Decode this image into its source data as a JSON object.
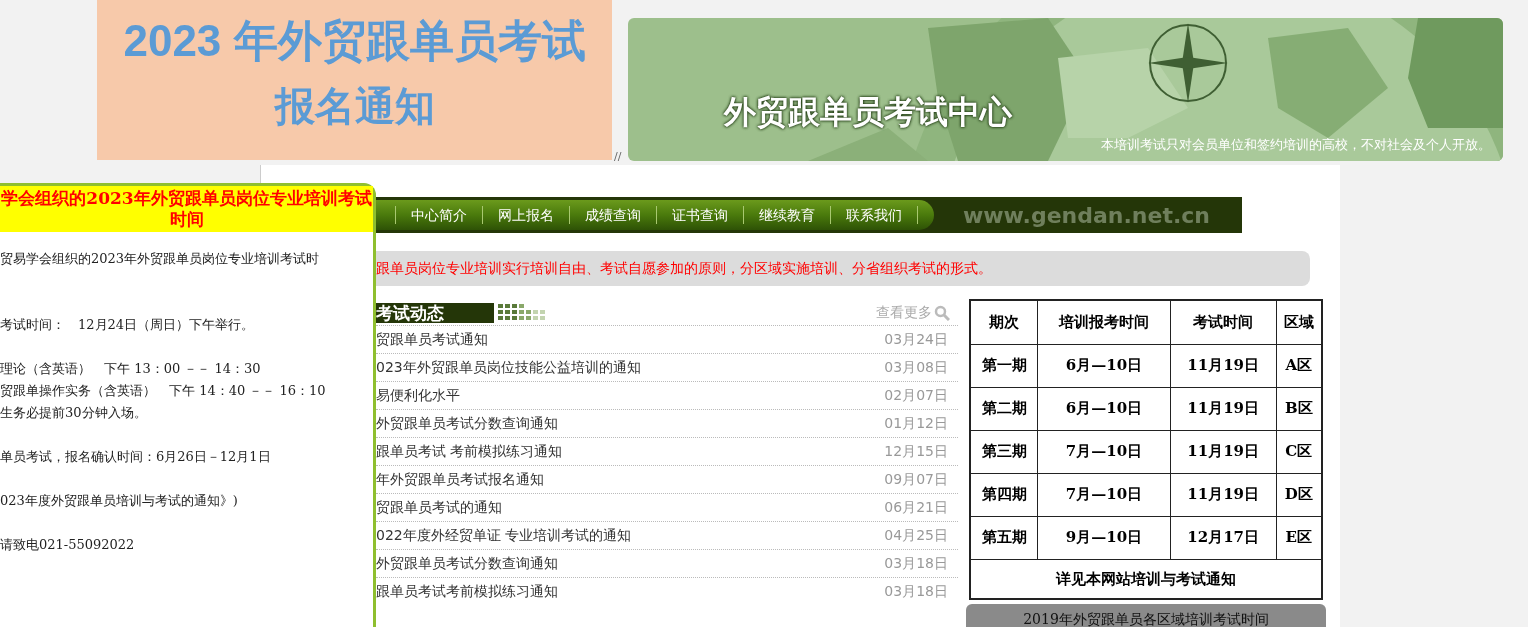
{
  "title_box": {
    "line_1": "2023 年外贸跟单员考试",
    "line_2": "报名通知"
  },
  "banner": {
    "kind": "picture",
    "heading": "外贸跟单员考试中心",
    "note": "本培训考试只对会员单位和签约培训的高校，不对社会及个人开放。"
  },
  "separator_mark": "//",
  "popup": {
    "title": "学会组织的2023年外贸跟单员岗位专业培训考试时间",
    "paragraphs": [
      [
        "贸易学会组织的2023年外贸跟单员岗位专业培训考试时"
      ],
      [
        "考试时间：　12月24日（周日）下午举行。"
      ],
      [
        "理论（含英语）　下午 13：00 －－ 14：30",
        "贸跟单操作实务（含英语）　下午 14：40 －－ 16：10",
        "生务必提前30分钟入场。"
      ],
      [
        "单员考试，报名确认时间：6月26日－12月1日"
      ],
      [
        "023年度外贸跟单员培训与考试的通知》)"
      ],
      [
        "请致电021-55092022"
      ]
    ]
  },
  "nav": {
    "items": [
      "中心简介",
      "网上报名",
      "成绩查询",
      "证书查询",
      "继续教育",
      "联系我们"
    ],
    "site": "www.gendan.net.cn"
  },
  "notice": "跟单员岗位专业培训实行培训自由、考试自愿参加的原则，分区域实施培训、分省组织考试的形式。",
  "news": {
    "heading": "考试动态",
    "more": "查看更多",
    "items": [
      {
        "title": "贸跟单员考试通知",
        "date": "03月24日"
      },
      {
        "title": "023年外贸跟单员岗位技能公益培训的通知",
        "date": "03月08日"
      },
      {
        "title": "易便利化水平",
        "date": "02月07日"
      },
      {
        "title": "外贸跟单员考试分数查询通知",
        "date": "01月12日"
      },
      {
        "title": "跟单员考试 考前模拟练习通知",
        "date": "12月15日"
      },
      {
        "title": "年外贸跟单员考试报名通知",
        "date": "09月07日"
      },
      {
        "title": "贸跟单员考试的通知",
        "date": "06月21日"
      },
      {
        "title": "022年度外经贸单证 专业培训考试的通知",
        "date": "04月25日"
      },
      {
        "title": "外贸跟单员考试分数查询通知",
        "date": "03月18日"
      },
      {
        "title": "跟单员考试考前模拟练习通知",
        "date": "03月18日"
      }
    ]
  },
  "schedule": {
    "columns": [
      "期次",
      "培训报考时间",
      "考试时间",
      "区域"
    ],
    "rows": [
      [
        "第一期",
        "6月—10日",
        "11月19日",
        "A区"
      ],
      [
        "第二期",
        "6月—10日",
        "11月19日",
        "B区"
      ],
      [
        "第三期",
        "7月—10日",
        "11月19日",
        "C区"
      ],
      [
        "第四期",
        "7月—10日",
        "11月19日",
        "D区"
      ],
      [
        "第五期",
        "9月—10日",
        "12月17日",
        "E区"
      ]
    ],
    "footer": "详见本网站培训与考试通知",
    "caption": "2019年外贸跟单员各区域培训考试时间"
  }
}
